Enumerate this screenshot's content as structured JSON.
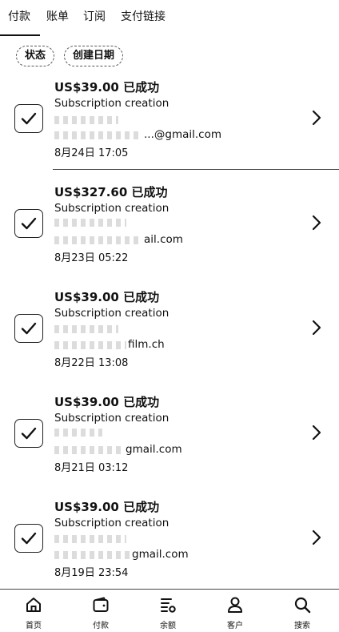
{
  "tabs": [
    {
      "label": "付款",
      "active": true
    },
    {
      "label": "账单"
    },
    {
      "label": "订阅"
    },
    {
      "label": "支付链接"
    }
  ],
  "filters": [
    {
      "label": "状态"
    },
    {
      "label": "创建日期"
    }
  ],
  "payments": [
    {
      "amount": "US$39.00 已成功",
      "description": "Subscription creation",
      "email": "...@gmail.com",
      "time": "8月24日 17:05"
    },
    {
      "amount": "US$327.60 已成功",
      "description": "Subscription creation",
      "email": "ail.com",
      "time": "8月23日 05:22"
    },
    {
      "amount": "US$39.00 已成功",
      "description": "Subscription creation",
      "email": "film.ch",
      "time": "8月22日 13:08"
    },
    {
      "amount": "US$39.00 已成功",
      "description": "Subscription creation",
      "email": "gmail.com",
      "time": "8月21日 03:12"
    },
    {
      "amount": "US$39.00 已成功",
      "description": "Subscription creation",
      "email": "gmail.com",
      "time": "8月19日 23:54"
    }
  ],
  "bottom_nav": [
    {
      "label": "首页",
      "icon": "home-icon"
    },
    {
      "label": "付款",
      "icon": "wallet-icon"
    },
    {
      "label": "余额",
      "icon": "balance-icon"
    },
    {
      "label": "客户",
      "icon": "person-icon"
    },
    {
      "label": "搜索",
      "icon": "search-icon"
    }
  ]
}
